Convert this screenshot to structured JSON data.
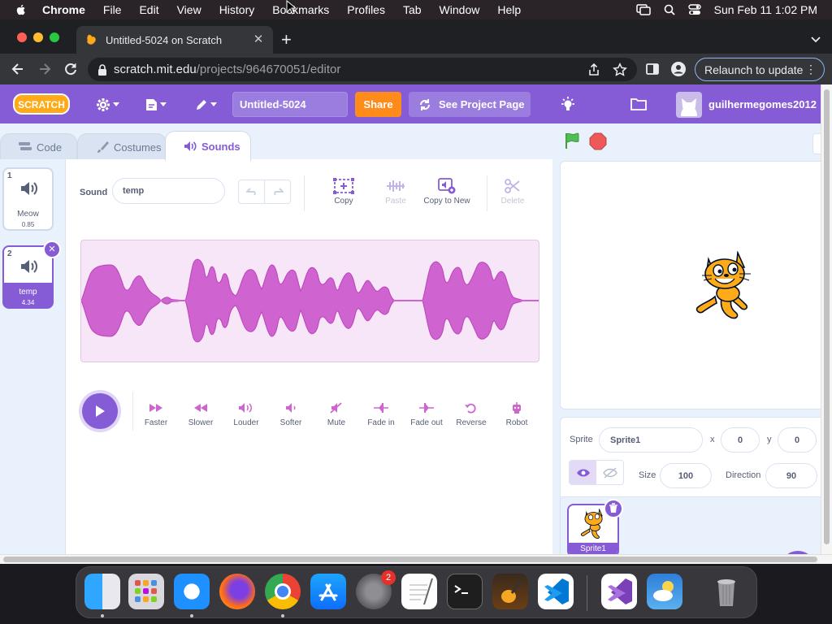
{
  "menubar": {
    "app_name": "Chrome",
    "items": [
      "File",
      "Edit",
      "View",
      "History",
      "Bookmarks",
      "Profiles",
      "Tab",
      "Window",
      "Help"
    ],
    "clock": "Sun Feb 11  1:02 PM"
  },
  "browser": {
    "tab_title": "Untitled-5024 on Scratch",
    "url_host": "scratch.mit.edu",
    "url_path": "/projects/964670051/editor",
    "relaunch_label": "Relaunch to update"
  },
  "scratch": {
    "logo_text": "SCRATCH",
    "project_title": "Untitled-5024",
    "share_label": "Share",
    "see_project_label": "See Project Page",
    "username": "guilhermegomes2012",
    "tabs": {
      "code": "Code",
      "costumes": "Costumes",
      "sounds": "Sounds"
    },
    "sounds": [
      {
        "index": "1",
        "name": "Meow",
        "duration": "0.85"
      },
      {
        "index": "2",
        "name": "temp",
        "duration": "4.34"
      }
    ],
    "editor": {
      "sound_label": "Sound",
      "sound_name": "temp",
      "tools": {
        "copy": "Copy",
        "paste": "Paste",
        "copy_to_new": "Copy to New",
        "delete": "Delete"
      },
      "effects": [
        "Faster",
        "Slower",
        "Louder",
        "Softer",
        "Mute",
        "Fade in",
        "Fade out",
        "Reverse",
        "Robot"
      ]
    },
    "sprite_info": {
      "sprite_label": "Sprite",
      "sprite_name": "Sprite1",
      "x_label": "x",
      "x_value": "0",
      "y_label": "y",
      "y_value": "0",
      "size_label": "Size",
      "size_value": "100",
      "direction_label": "Direction",
      "direction_value": "90"
    },
    "sprites": [
      {
        "name": "Sprite1"
      }
    ],
    "colors": {
      "primary": "#855cd6",
      "share": "#ff8c1a",
      "waveform": "#cf63cf"
    }
  },
  "dock": {
    "apps": [
      "finder-icon",
      "launchpad-icon",
      "safari-icon",
      "firefox-icon",
      "chrome-icon",
      "app-store-icon",
      "system-settings-icon",
      "textedit-icon",
      "terminal-icon",
      "garageband-icon",
      "vscode-icon",
      "visual-studio-icon",
      "weather-icon",
      "trash-icon"
    ],
    "settings_badge": "2"
  }
}
